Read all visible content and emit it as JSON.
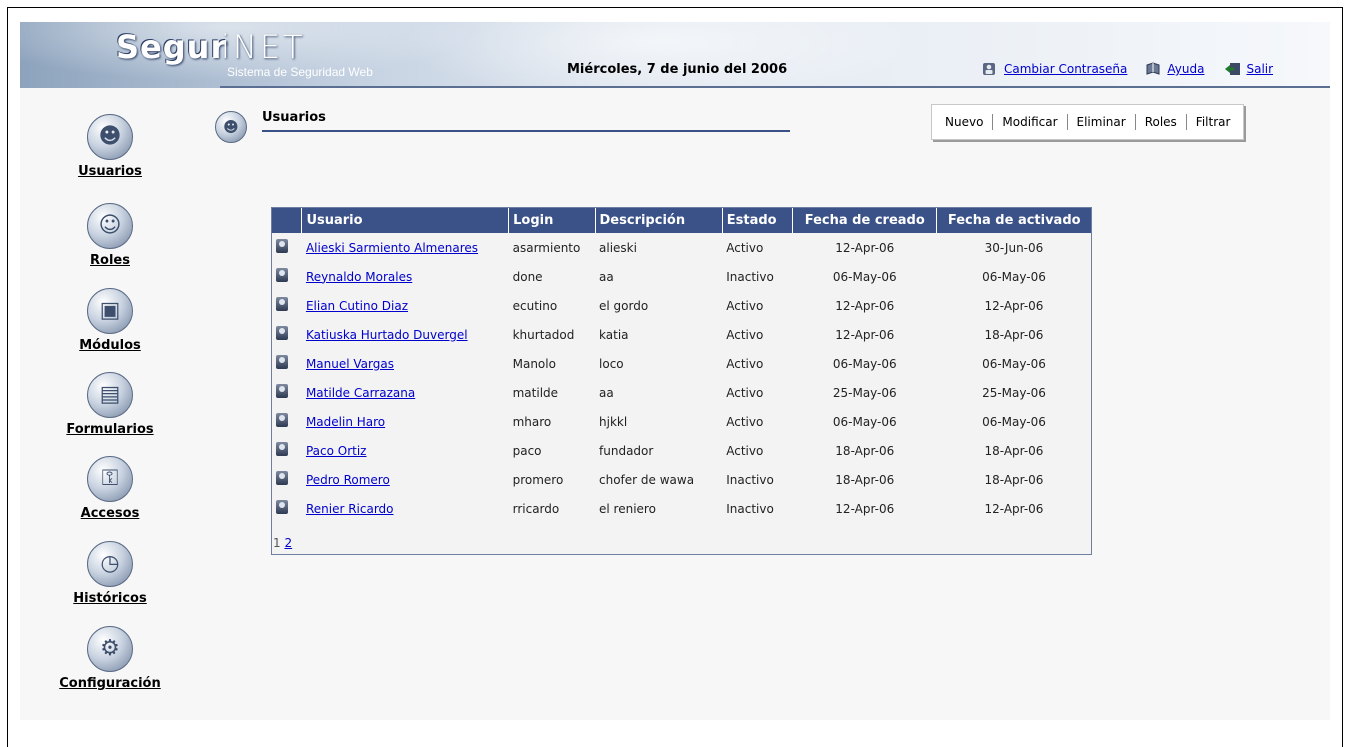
{
  "app": {
    "logo_part1": "Segur",
    "logo_part2": "iNET",
    "subtitle": "Sistema de Seguridad Web",
    "date": "Miércoles, 7 de junio del 2006"
  },
  "top_links": [
    {
      "label": "Cambiar Contraseña",
      "icon": "key-icon"
    },
    {
      "label": "Ayuda",
      "icon": "book-icon"
    },
    {
      "label": "Salir",
      "icon": "exit-icon"
    }
  ],
  "sidebar": {
    "items": [
      {
        "label": "Usuarios",
        "icon": "users-icon"
      },
      {
        "label": "Roles",
        "icon": "role-icon"
      },
      {
        "label": "Módulos",
        "icon": "modules-icon"
      },
      {
        "label": "Formularios",
        "icon": "forms-icon"
      },
      {
        "label": "Accesos",
        "icon": "keys-icon"
      },
      {
        "label": "Históricos",
        "icon": "history-clock-icon"
      },
      {
        "label": "Configuración",
        "icon": "gears-icon"
      }
    ]
  },
  "section": {
    "title": "Usuarios"
  },
  "toolbar": {
    "buttons": [
      "Nuevo",
      "Modificar",
      "Eliminar",
      "Roles",
      "Filtrar"
    ]
  },
  "table": {
    "columns": [
      "Usuario",
      "Login",
      "Descripción",
      "Estado",
      "Fecha de creado",
      "Fecha de activado"
    ],
    "rows": [
      {
        "usuario": "Alieski Sarmiento Almenares",
        "login": "asarmiento",
        "descripcion": "alieski",
        "estado": "Activo",
        "creado": "12-Apr-06",
        "activado": "30-Jun-06"
      },
      {
        "usuario": "Reynaldo Morales",
        "login": "done",
        "descripcion": "aa",
        "estado": "Inactivo",
        "creado": "06-May-06",
        "activado": "06-May-06"
      },
      {
        "usuario": "Elian Cutino Diaz",
        "login": "ecutino",
        "descripcion": "el gordo",
        "estado": "Activo",
        "creado": "12-Apr-06",
        "activado": "12-Apr-06"
      },
      {
        "usuario": "Katiuska Hurtado Duvergel",
        "login": "khurtadod",
        "descripcion": "katia",
        "estado": "Activo",
        "creado": "12-Apr-06",
        "activado": "18-Apr-06"
      },
      {
        "usuario": "Manuel Vargas",
        "login": "Manolo",
        "descripcion": "loco",
        "estado": "Activo",
        "creado": "06-May-06",
        "activado": "06-May-06"
      },
      {
        "usuario": "Matilde Carrazana",
        "login": "matilde",
        "descripcion": "aa",
        "estado": "Activo",
        "creado": "25-May-06",
        "activado": "25-May-06"
      },
      {
        "usuario": "Madelin Haro",
        "login": "mharo",
        "descripcion": "hjkkl",
        "estado": "Activo",
        "creado": "06-May-06",
        "activado": "06-May-06"
      },
      {
        "usuario": "Paco Ortiz",
        "login": "paco",
        "descripcion": "fundador",
        "estado": "Activo",
        "creado": "18-Apr-06",
        "activado": "18-Apr-06"
      },
      {
        "usuario": "Pedro Romero",
        "login": "promero",
        "descripcion": "chofer de wawa",
        "estado": "Inactivo",
        "creado": "18-Apr-06",
        "activado": "18-Apr-06"
      },
      {
        "usuario": "Renier Ricardo",
        "login": "rricardo",
        "descripcion": "el reniero",
        "estado": "Inactivo",
        "creado": "12-Apr-06",
        "activado": "12-Apr-06"
      }
    ]
  },
  "pager": {
    "current": "1",
    "next": "2"
  }
}
